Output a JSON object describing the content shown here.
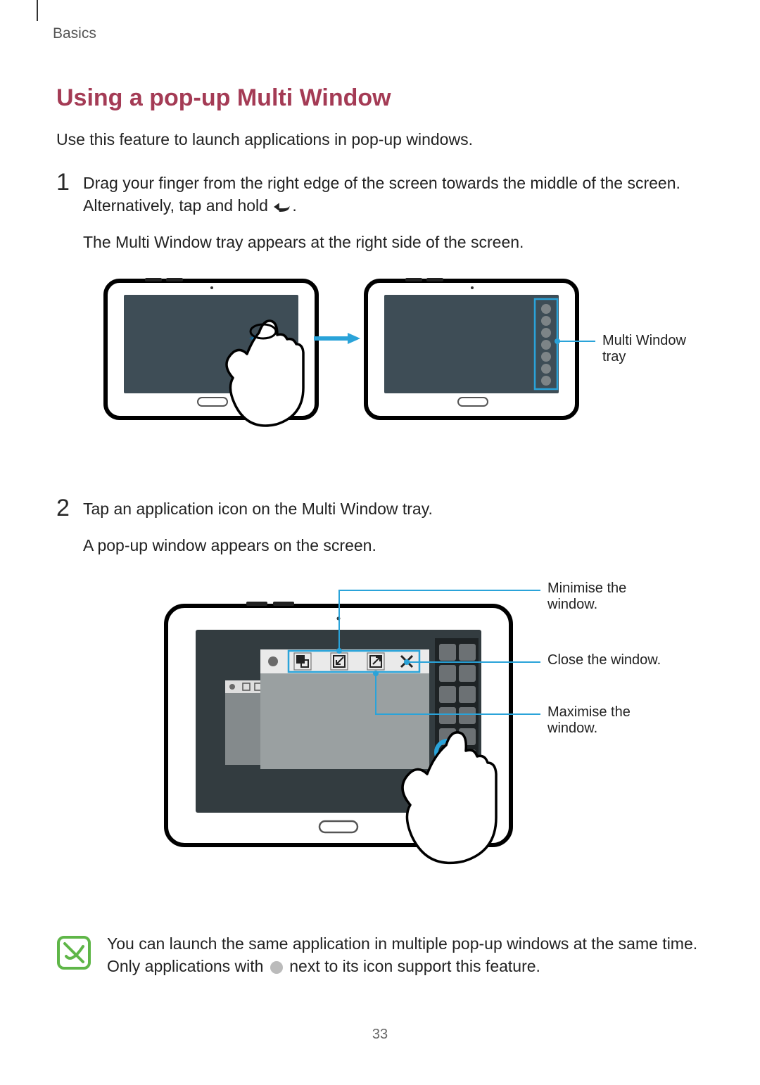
{
  "header": {
    "section": "Basics"
  },
  "title": "Using a pop-up Multi Window",
  "intro": "Use this feature to launch applications in pop-up windows.",
  "steps": {
    "s1": {
      "num": "1",
      "line1a": "Drag your finger from the right edge of the screen towards the middle of the screen. Alternatively, tap and hold ",
      "line1b": ".",
      "line2": "The Multi Window tray appears at the right side of the screen."
    },
    "s2": {
      "num": "2",
      "line1": "Tap an application icon on the Multi Window tray.",
      "line2": "A pop-up window appears on the screen."
    }
  },
  "fig1": {
    "callout_tray": "Multi Window tray"
  },
  "fig2": {
    "callout_min": "Minimise the window.",
    "callout_close": "Close the window.",
    "callout_max": "Maximise the window."
  },
  "note": {
    "text_a": "You can launch the same application in multiple pop-up windows at the same time. Only applications with ",
    "text_b": " next to its icon support this feature."
  },
  "page": "33"
}
